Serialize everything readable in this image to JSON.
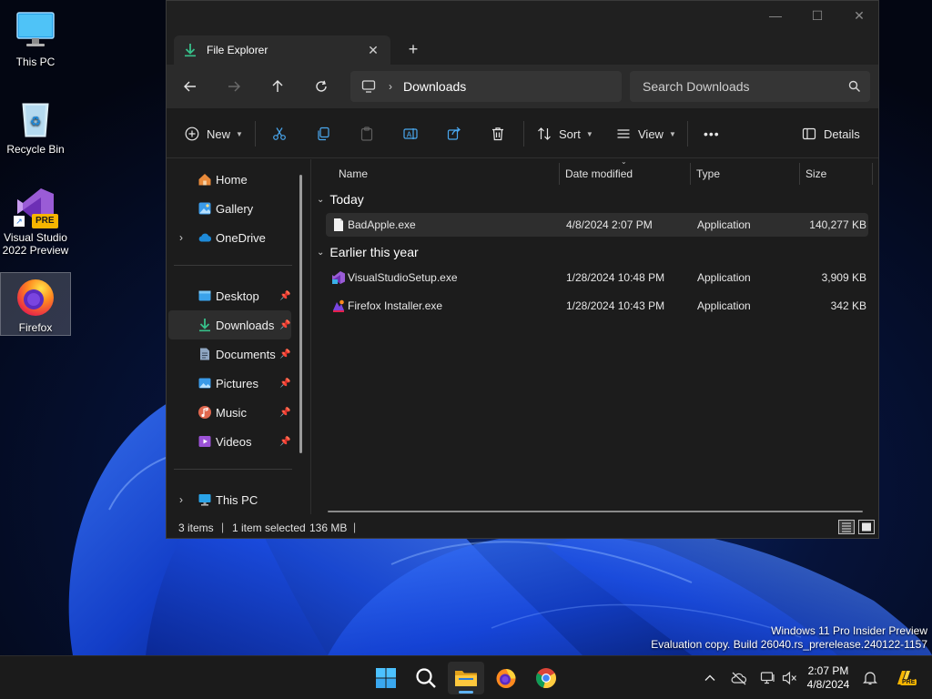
{
  "desktop": {
    "icons": [
      {
        "label": "This PC",
        "icon": "monitor-icon"
      },
      {
        "label": "Recycle Bin",
        "icon": "recycle-bin-icon"
      },
      {
        "label": "Visual Studio 2022 Preview",
        "badge": "PRE",
        "icon": "visual-studio-icon"
      },
      {
        "label": "Firefox",
        "icon": "firefox-icon"
      }
    ],
    "watermark": {
      "line1": "Windows 11 Pro Insider Preview",
      "line2": "Evaluation copy. Build 26040.rs_prerelease.240122-1157"
    }
  },
  "window": {
    "tab_title": "File Explorer",
    "tab_close": "✕",
    "new_tab": "+",
    "controls": {
      "minimize": "—",
      "maximize": "☐",
      "close": "✕"
    },
    "address": {
      "location": "Downloads"
    },
    "search": {
      "placeholder": "Search Downloads"
    },
    "toolbar": {
      "new_label": "New",
      "sort_label": "Sort",
      "view_label": "View",
      "more_label": "•••",
      "details_label": "Details"
    },
    "sidebar": {
      "items": [
        {
          "label": "Home",
          "icon": "home-icon"
        },
        {
          "label": "Gallery",
          "icon": "gallery-icon"
        },
        {
          "label": "OneDrive",
          "icon": "onedrive-icon",
          "expandable": true
        },
        {
          "label": "Desktop",
          "icon": "desktop-icon",
          "pinned": true
        },
        {
          "label": "Downloads",
          "icon": "download-icon",
          "pinned": true,
          "selected": true
        },
        {
          "label": "Documents",
          "icon": "documents-icon",
          "pinned": true
        },
        {
          "label": "Pictures",
          "icon": "pictures-icon",
          "pinned": true
        },
        {
          "label": "Music",
          "icon": "music-icon",
          "pinned": true
        },
        {
          "label": "Videos",
          "icon": "videos-icon",
          "pinned": true
        },
        {
          "label": "This PC",
          "icon": "this-pc-icon",
          "expandable": true
        }
      ]
    },
    "columns": {
      "name": "Name",
      "date": "Date modified",
      "type": "Type",
      "size": "Size"
    },
    "groups": [
      {
        "title": "Today",
        "files": [
          {
            "name": "BadApple.exe",
            "date": "4/8/2024 2:07 PM",
            "type": "Application",
            "size": "140,277 KB",
            "selected": true
          }
        ]
      },
      {
        "title": "Earlier this year",
        "files": [
          {
            "name": "VisualStudioSetup.exe",
            "date": "1/28/2024 10:48 PM",
            "type": "Application",
            "size": "3,909 KB"
          },
          {
            "name": "Firefox Installer.exe",
            "date": "1/28/2024 10:43 PM",
            "type": "Application",
            "size": "342 KB"
          }
        ]
      }
    ],
    "status": {
      "items": "3 items",
      "selected": "1 item selected",
      "size": "136 MB"
    }
  },
  "taskbar": {
    "clock_time": "2:07 PM",
    "clock_date": "4/8/2024",
    "tray_badge": "PRE"
  },
  "colors": {
    "accent": "#5fb2f2",
    "window_bg": "#1c1c1c",
    "toolbar_bg": "#2b2b2b"
  }
}
